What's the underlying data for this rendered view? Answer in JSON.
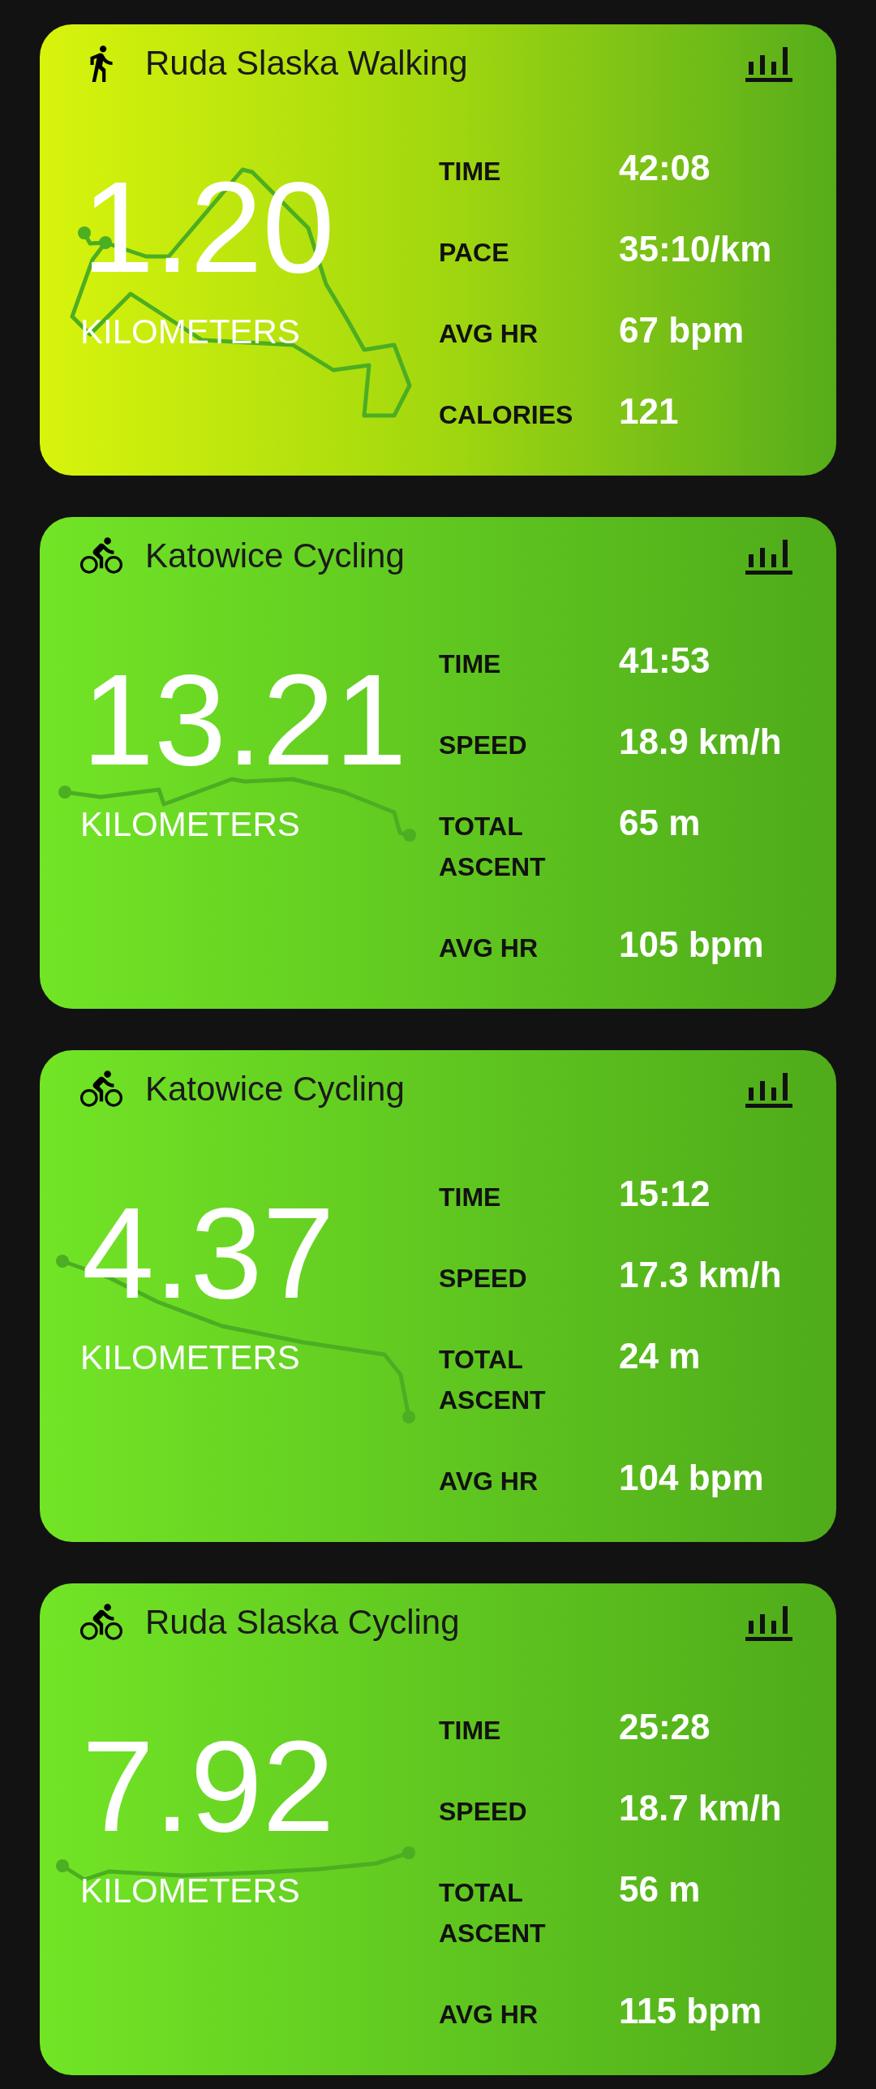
{
  "activities": [
    {
      "kind": "walking",
      "title": "Ruda Slaska Walking",
      "distance": "1.20",
      "unit": "KILOMETERS",
      "stats": [
        {
          "label": "TIME",
          "value": "42:08"
        },
        {
          "label": "PACE",
          "value": "35:10/km"
        },
        {
          "label": "AVG HR",
          "value": "67 bpm"
        },
        {
          "label": "CALORIES",
          "value": "121"
        }
      ]
    },
    {
      "kind": "cycling",
      "title": "Katowice Cycling",
      "distance": "13.21",
      "unit": "KILOMETERS",
      "stats": [
        {
          "label": "TIME",
          "value": "41:53"
        },
        {
          "label": "SPEED",
          "value": "18.9 km/h"
        },
        {
          "label": "TOTAL ASCENT",
          "value": "65 m"
        },
        {
          "label": "AVG HR",
          "value": "105 bpm"
        }
      ]
    },
    {
      "kind": "cycling",
      "title": "Katowice Cycling",
      "distance": "4.37",
      "unit": "KILOMETERS",
      "stats": [
        {
          "label": "TIME",
          "value": "15:12"
        },
        {
          "label": "SPEED",
          "value": "17.3 km/h"
        },
        {
          "label": "TOTAL ASCENT",
          "value": "24 m"
        },
        {
          "label": "AVG HR",
          "value": "104 bpm"
        }
      ]
    },
    {
      "kind": "cycling",
      "title": "Ruda Slaska Cycling",
      "distance": "7.92",
      "unit": "KILOMETERS",
      "stats": [
        {
          "label": "TIME",
          "value": "25:28"
        },
        {
          "label": "SPEED",
          "value": "18.7 km/h"
        },
        {
          "label": "TOTAL ASCENT",
          "value": "56 m"
        },
        {
          "label": "AVG HR",
          "value": "115 bpm"
        }
      ]
    }
  ]
}
